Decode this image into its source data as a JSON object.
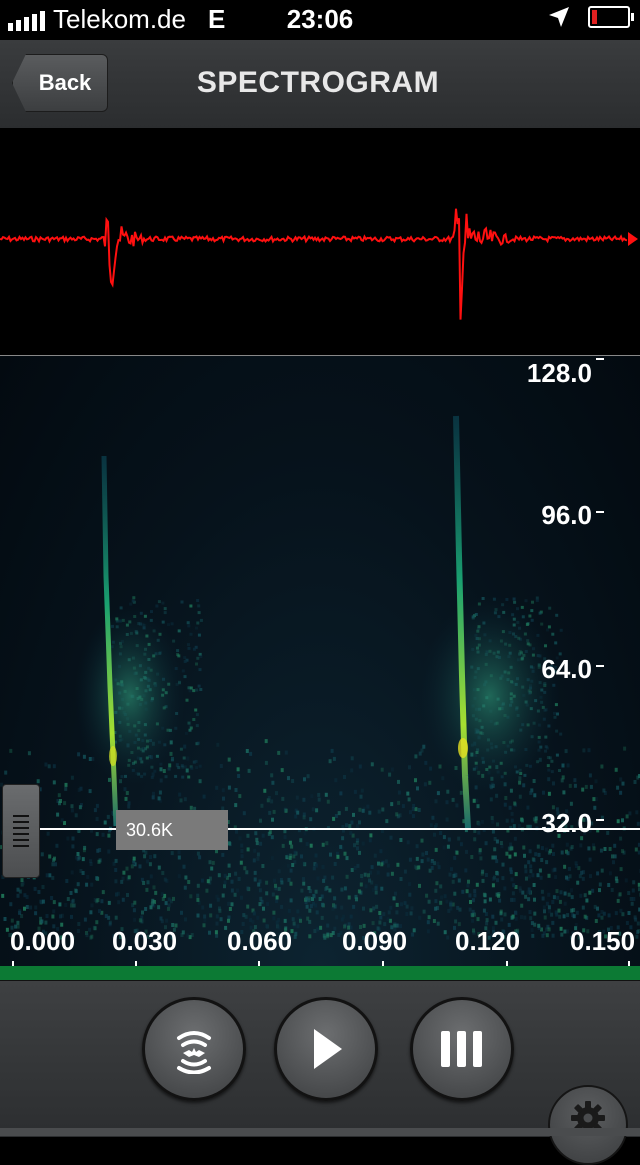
{
  "status": {
    "carrier": "Telekom.de",
    "network": "E",
    "time": "23:06",
    "battery_level": 0.15,
    "battery_color": "#e02020"
  },
  "nav": {
    "back_label": "Back",
    "title": "SPECTROGRAM"
  },
  "waveform": {
    "color": "#ff1010"
  },
  "spectrogram": {
    "y_axis": [
      "128.0",
      "96.0",
      "64.0",
      "32.0"
    ],
    "x_axis": [
      "0.000",
      "0.030",
      "0.060",
      "0.090",
      "0.120",
      "0.150"
    ],
    "cursor_readout": "30.6K",
    "timeline_color": "#0c7a34"
  },
  "controls": {
    "icons": [
      "bat-detector-icon",
      "play-icon",
      "pause-icon",
      "gear-icon"
    ]
  }
}
